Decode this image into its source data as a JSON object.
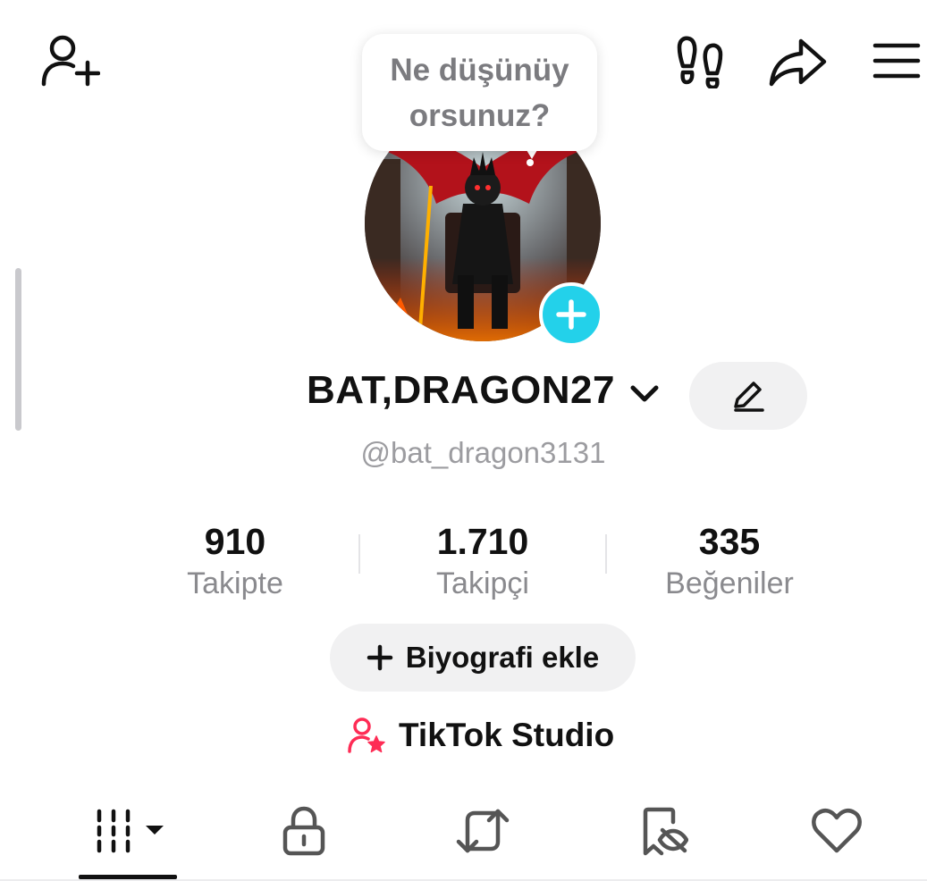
{
  "topbar": {
    "add_friend_icon": "person-plus-icon",
    "footprints_icon": "footprints-icon",
    "share_icon": "share-arrow-icon",
    "menu_icon": "hamburger-menu-icon"
  },
  "story_bubble": {
    "line1": "Ne düşünüy",
    "line2": "orsunuz?"
  },
  "profile": {
    "avatar_desc_icon": "profile-avatar",
    "add_icon": "plus-icon",
    "display_name": "BAT,DRAGON27",
    "username": "@bat_dragon3131"
  },
  "stats": [
    {
      "value": "910",
      "label": "Takipte"
    },
    {
      "value": "1.710",
      "label": "Takipçi"
    },
    {
      "value": "335",
      "label": "Beğeniler"
    }
  ],
  "bio_button": {
    "label": "Biyografi ekle"
  },
  "studio_link": {
    "label": "TikTok Studio"
  },
  "tabs": [
    {
      "name": "videos-grid-tab",
      "icon": "grid-bars-icon",
      "active": true
    },
    {
      "name": "private-tab",
      "icon": "lock-icon",
      "active": false
    },
    {
      "name": "reposts-tab",
      "icon": "repost-icon",
      "active": false
    },
    {
      "name": "favorites-tab",
      "icon": "bookmark-hidden-icon",
      "active": false
    },
    {
      "name": "liked-tab",
      "icon": "heart-icon",
      "active": false
    }
  ],
  "colors": {
    "accent_cyan": "#23d1ea",
    "studio_pink": "#fe2c55",
    "muted_text": "#8a8a8e",
    "pill_bg": "#f1f1f2"
  }
}
